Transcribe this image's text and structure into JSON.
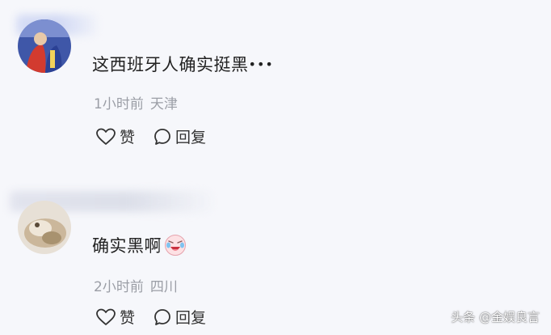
{
  "comments": [
    {
      "text": "这西班牙人确实挺黑",
      "ellipsis": "•••",
      "time": "1小时前",
      "location": "天津",
      "like_label": "赞",
      "reply_label": "回复"
    },
    {
      "text": "确实黑啊",
      "time": "2小时前",
      "location": "四川",
      "like_label": "赞",
      "reply_label": "回复"
    }
  ],
  "watermark": "头条 @金娱良言",
  "icons": {
    "like": "heart-outline-icon",
    "reply": "chat-bubble-icon",
    "emoji": "crying-laughing-emoji"
  },
  "colors": {
    "background": "#f6f7fb",
    "text": "#222222",
    "meta": "#9b9ea6"
  }
}
